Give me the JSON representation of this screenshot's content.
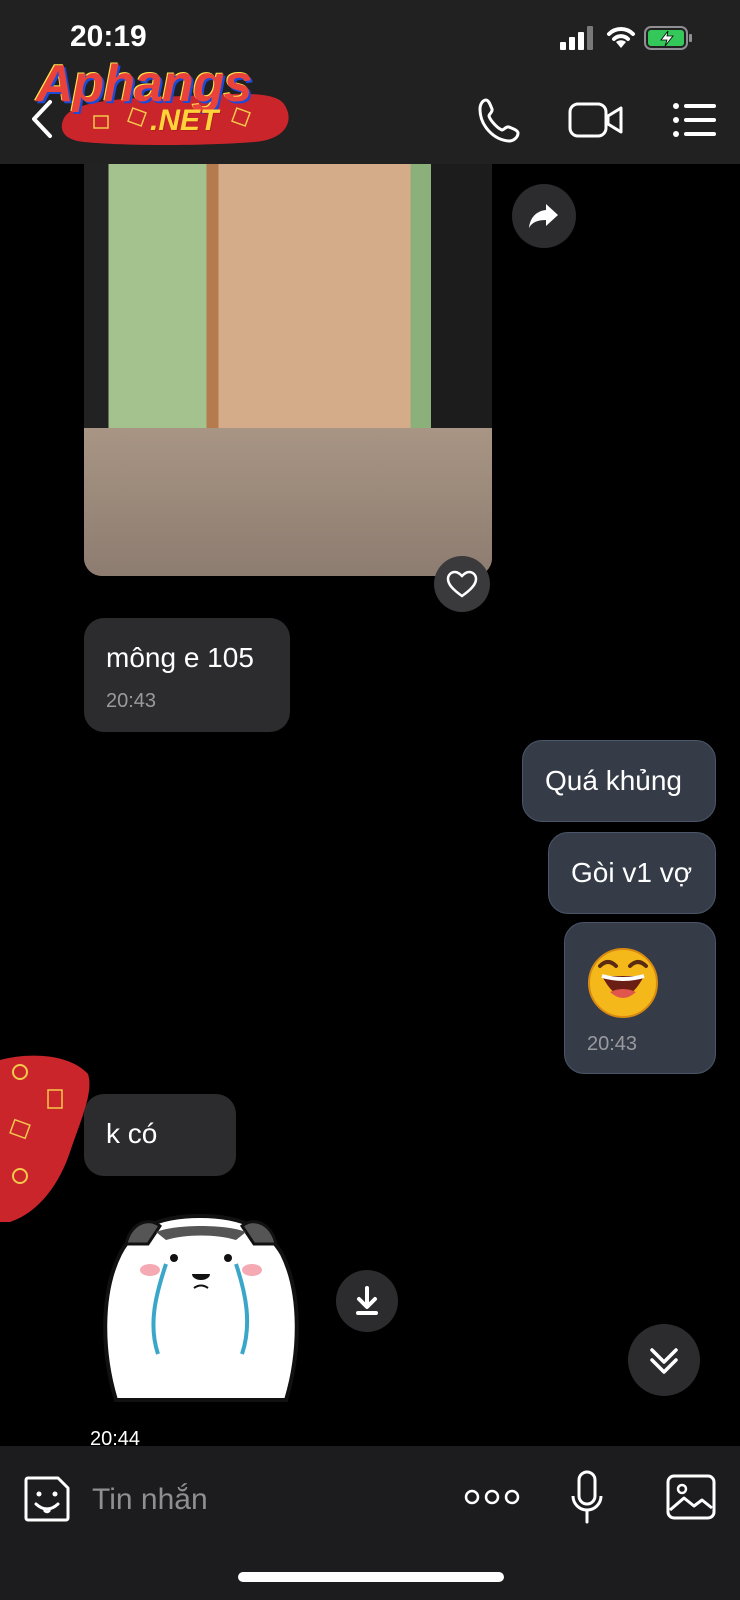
{
  "status_bar": {
    "time": "20:19"
  },
  "header": {
    "logo_text": "Aphangs",
    "logo_sub": ".NET"
  },
  "messages": {
    "incoming_1": {
      "text": "mông e 105",
      "time": "20:43"
    },
    "outgoing_1": {
      "text": "Quá khủng"
    },
    "outgoing_2": {
      "text": "Gòi v1 vợ"
    },
    "outgoing_3": {
      "emoji": "laughing-emoji",
      "time": "20:43"
    },
    "incoming_2": {
      "text": "k có"
    },
    "incoming_sticker": {
      "sticker": "crying-bear-sticker",
      "time": "20:44"
    }
  },
  "composer": {
    "placeholder": "Tin nhắn"
  },
  "colors": {
    "background": "#000000",
    "bar": "#1c1c1e",
    "bubble_incoming": "#2c2c2e",
    "bubble_outgoing": "#353c48"
  }
}
